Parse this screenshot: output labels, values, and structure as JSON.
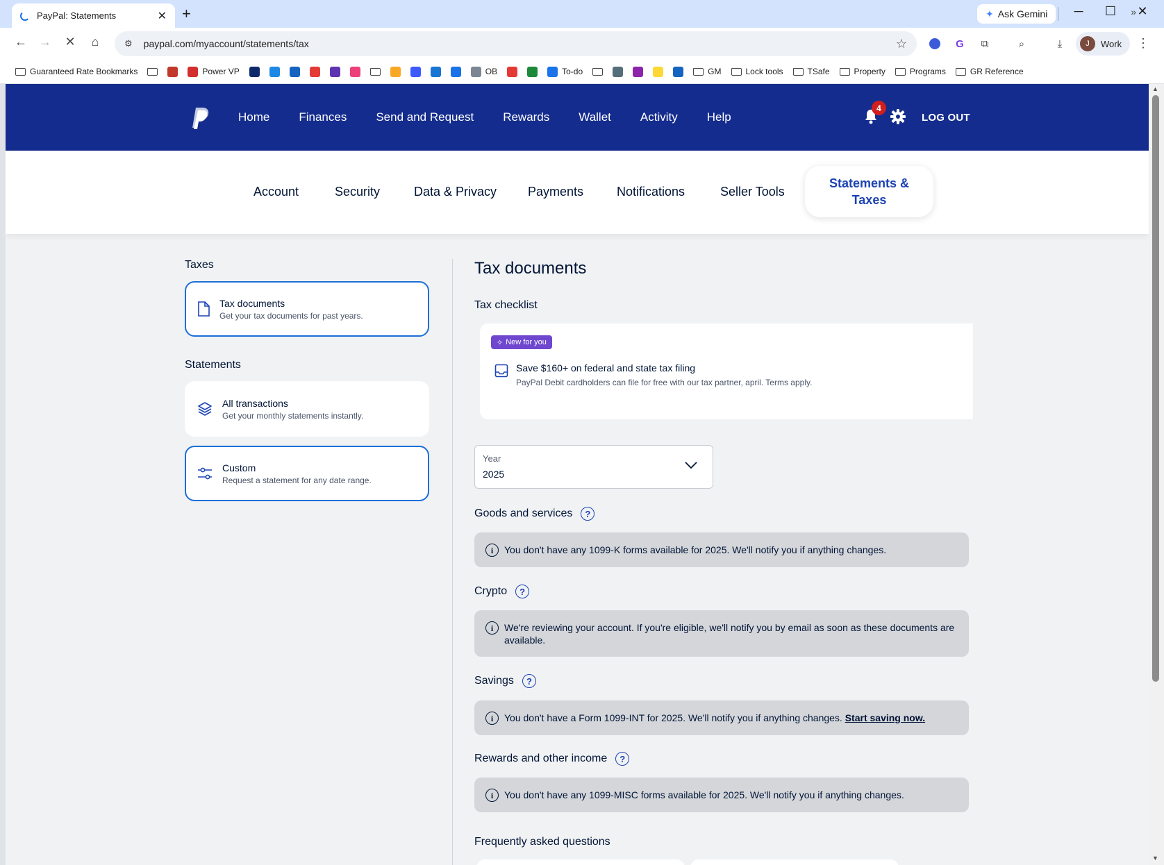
{
  "browser": {
    "tab_title": "PayPal: Statements",
    "new_tab": "+",
    "gemini_label": "Ask Gemini",
    "url": "paypal.com/myaccount/statements/tax",
    "profile_initial": "J",
    "profile_name": "Work"
  },
  "bookmarks": [
    {
      "label": "Guaranteed Rate Bookmarks",
      "kind": "folder-gear"
    },
    {
      "label": "",
      "kind": "folder"
    },
    {
      "label": "",
      "kind": "fav",
      "color": "#c0392b"
    },
    {
      "label": "Power VP",
      "kind": "fav",
      "color": "#d32f2f"
    },
    {
      "label": "",
      "kind": "fav",
      "color": "#0f2a6b"
    },
    {
      "label": "",
      "kind": "fav",
      "color": "#1e88e5"
    },
    {
      "label": "",
      "kind": "fav",
      "color": "#1565c0"
    },
    {
      "label": "",
      "kind": "fav",
      "color": "#e53935"
    },
    {
      "label": "",
      "kind": "fav",
      "color": "#5e35b1"
    },
    {
      "label": "",
      "kind": "fav",
      "color": "#ec407a"
    },
    {
      "label": "",
      "kind": "folder"
    },
    {
      "label": "",
      "kind": "fav",
      "color": "#f9a825"
    },
    {
      "label": "",
      "kind": "fav",
      "color": "#3d5afe"
    },
    {
      "label": "",
      "kind": "fav",
      "color": "#1976d2"
    },
    {
      "label": "",
      "kind": "fav",
      "color": "#1a73e8"
    },
    {
      "label": "OB",
      "kind": "fav",
      "color": "#7b8794"
    },
    {
      "label": "",
      "kind": "fav",
      "color": "#e53935"
    },
    {
      "label": "",
      "kind": "fav",
      "color": "#1b8a3a"
    },
    {
      "label": "To-do",
      "kind": "fav",
      "color": "#1a73e8"
    },
    {
      "label": "",
      "kind": "folder"
    },
    {
      "label": "",
      "kind": "fav",
      "color": "#546e7a"
    },
    {
      "label": "",
      "kind": "fav",
      "color": "#8e24aa"
    },
    {
      "label": "",
      "kind": "fav",
      "color": "#fdd835"
    },
    {
      "label": "",
      "kind": "fav",
      "color": "#1565c0"
    },
    {
      "label": "GM",
      "kind": "folder"
    },
    {
      "label": "Lock tools",
      "kind": "folder"
    },
    {
      "label": "TSafe",
      "kind": "folder"
    },
    {
      "label": "Property",
      "kind": "folder"
    },
    {
      "label": "Programs",
      "kind": "folder"
    },
    {
      "label": "GR Reference",
      "kind": "folder"
    }
  ],
  "header": {
    "nav": [
      "Home",
      "Finances",
      "Send and Request",
      "Rewards",
      "Wallet",
      "Activity",
      "Help"
    ],
    "notification_count": "4",
    "logout": "LOG OUT"
  },
  "subnav": {
    "items": [
      "Account",
      "Security",
      "Data & Privacy",
      "Payments",
      "Notifications",
      "Seller Tools"
    ],
    "active": "Statements & Taxes"
  },
  "sidebar": {
    "taxes_heading": "Taxes",
    "statements_heading": "Statements",
    "tax_documents": {
      "title": "Tax documents",
      "desc": "Get your tax documents for past years."
    },
    "all_transactions": {
      "title": "All transactions",
      "desc": "Get your monthly statements instantly."
    },
    "custom": {
      "title": "Custom",
      "desc": "Request a statement for any date range."
    }
  },
  "main": {
    "title": "Tax documents",
    "checklist_heading": "Tax checklist",
    "checklist": {
      "badge": "New for you",
      "title": "Save $160+ on federal and state tax filing",
      "desc": "PayPal Debit cardholders can file for free with our tax partner, april. Terms apply."
    },
    "year": {
      "label": "Year",
      "value": "2025"
    },
    "sections": {
      "goods": {
        "heading": "Goods and services",
        "notice": "You don't have any 1099-K forms available for 2025. We'll notify you if anything changes."
      },
      "crypto": {
        "heading": "Crypto",
        "notice": "We're reviewing your account. If you're eligible, we'll notify you by email as soon as these documents are available."
      },
      "savings": {
        "heading": "Savings",
        "notice": "You don't have a Form 1099-INT for 2025. We'll notify you if anything changes.",
        "link": "Start saving now."
      },
      "rewards": {
        "heading": "Rewards and other income",
        "notice": "You don't have any 1099-MISC forms available for 2025. We'll notify you if anything changes."
      }
    },
    "faq_heading": "Frequently asked questions"
  },
  "colors": {
    "header_bg": "#142c8e",
    "accent_blue": "#1c43b4",
    "selected_border": "#1c6fd8",
    "badge_purple": "#6f47cf",
    "notification_red": "#d11e1e"
  }
}
